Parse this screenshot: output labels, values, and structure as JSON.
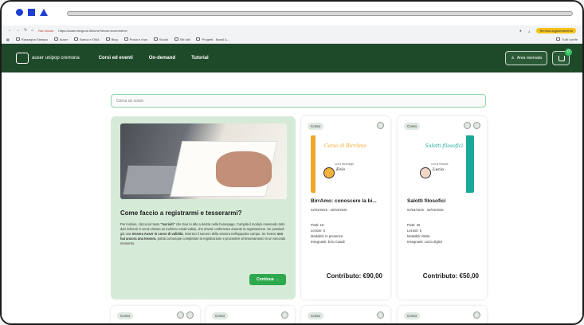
{
  "browser": {
    "not_secure": "Non sicuro",
    "url": "https://auser.dergoos.it/home?show=ecommerce",
    "update_label": "Termina aggiornamento",
    "bookmarks": [
      "Rassegna Stampa",
      "Auser",
      "Banca e ONA",
      "Blog",
      "Posta e chat",
      "Social",
      "Siti utili",
      "Progetti - Bandi &..."
    ],
    "all_bookmarks": "Tutti i prefe"
  },
  "header": {
    "logo_text": "auser unipop cremona",
    "menu": [
      "Corsi ed eventi",
      "On-demand",
      "Tutorial"
    ],
    "area_label": "Area riservata",
    "cart_badge": "0"
  },
  "search": {
    "placeholder": "Cerca un corso"
  },
  "info_card": {
    "title": "Come faccio a registrarmi e tesserarmi?",
    "p1": "Per iniziare, clicca sul tasto ",
    "b1": "\"Iscriviti\"",
    "p2": " che trovi in alto a destra nella homepage. Compila il modulo inserendo tutti i dati richiesti: ti verrà chiesto un indirizzo email valido, che dovrai confermare durante la registrazione. Se possiedi già una ",
    "b2": "tessera Auser in corso di validità",
    "p3": ", inserisci il numero della tessera nell'apposito campo. Se invece ",
    "b3": "non hai ancora una tessera",
    "p4": ", potrai comunque completare la registrazione e procedere al tesseramento in un secondo momento.",
    "button": "Continua →"
  },
  "cards": [
    {
      "tag": "Corso",
      "thumb_title": "Corso di BirrAmo",
      "thumb_sub": "con il tecnologo",
      "thumb_name": "Ezio",
      "title": "BirrAmo: conoscere la bi...",
      "date": "02/04/2025 - 30/04/2025",
      "meta": [
        "Posti: 15",
        "Lezioni: 5",
        "Modalità: In presenza",
        "Insegnanti: Ezio Casali"
      ],
      "price": "Contributo: €90,00",
      "accent": "#f4a62a"
    },
    {
      "tag": "Corso",
      "thumb_title": "Salotti filosofici",
      "thumb_sub": "con la filosofa",
      "thumb_name": "Lucia",
      "title": "Salotti filosofici",
      "date": "02/04/2025 - 30/04/2025",
      "meta": [
        "Posti: 20",
        "Lezioni: 5",
        "Modalità: Mista",
        "Insegnanti: Lucia Zigliol"
      ],
      "price": "Contributo: €50,00",
      "accent": "#1aa89a"
    }
  ],
  "bottom_tags": [
    "Corso",
    "Corso",
    "Corso",
    "Corso"
  ]
}
